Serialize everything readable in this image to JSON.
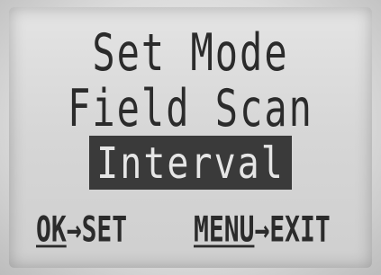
{
  "screen": {
    "title": "Set Mode",
    "mode": "Field Scan",
    "selected_option": "Interval"
  },
  "footer": {
    "ok_key": "OK",
    "ok_action": "→SET",
    "menu_key": "MENU",
    "menu_action": "→EXIT"
  }
}
